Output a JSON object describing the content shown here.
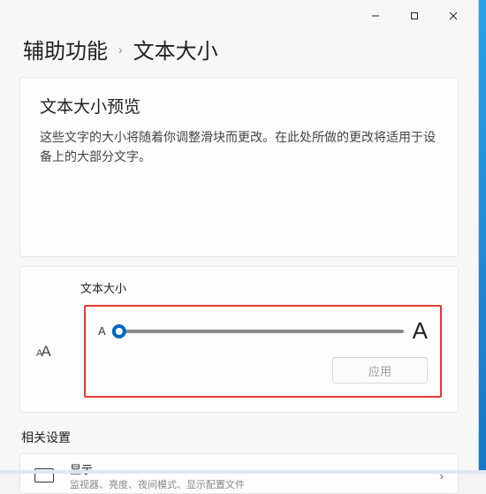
{
  "breadcrumb": {
    "parent": "辅助功能",
    "current": "文本大小"
  },
  "preview": {
    "title": "文本大小预览",
    "desc": "这些文字的大小将随着你调整滑块而更改。在此处所做的更改将适用于设备上的大部分文字。"
  },
  "slider": {
    "label": "文本大小",
    "min_glyph": "A",
    "max_glyph": "A",
    "apply_label": "应用",
    "percent": 0
  },
  "related": {
    "heading": "相关设置",
    "display": {
      "title": "显示",
      "sub": "监视器、亮度、夜间模式、显示配置文件"
    }
  }
}
